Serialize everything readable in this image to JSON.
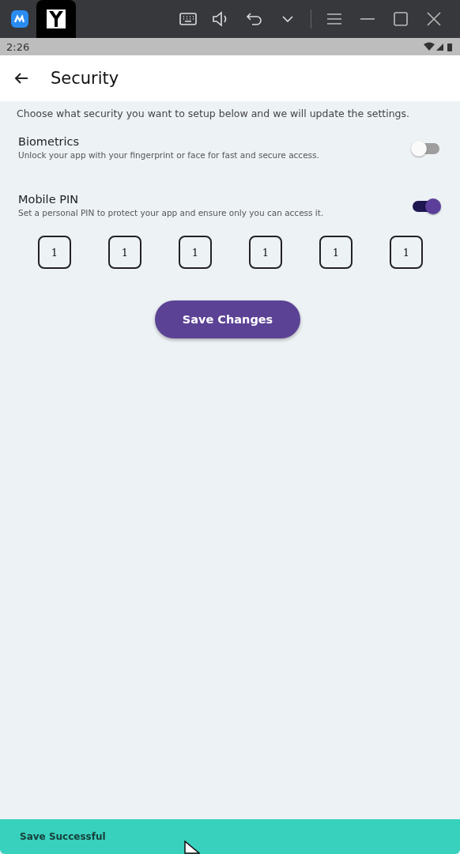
{
  "status_bar": {
    "time": "2:26"
  },
  "app_bar": {
    "title": "Security"
  },
  "intro": "Choose what security you want to setup below and we will update the settings.",
  "settings": [
    {
      "title": "Biometrics",
      "description": "Unlock your app with your fingerprint or face for fast and secure access.",
      "on": false
    },
    {
      "title": "Mobile PIN",
      "description": "Set a personal PIN to protect your app and ensure only you can access it.",
      "on": true
    }
  ],
  "pin_digits": [
    "1",
    "1",
    "1",
    "1",
    "1",
    "1"
  ],
  "save_button": "Save Changes",
  "snackbar": "Save Successful"
}
